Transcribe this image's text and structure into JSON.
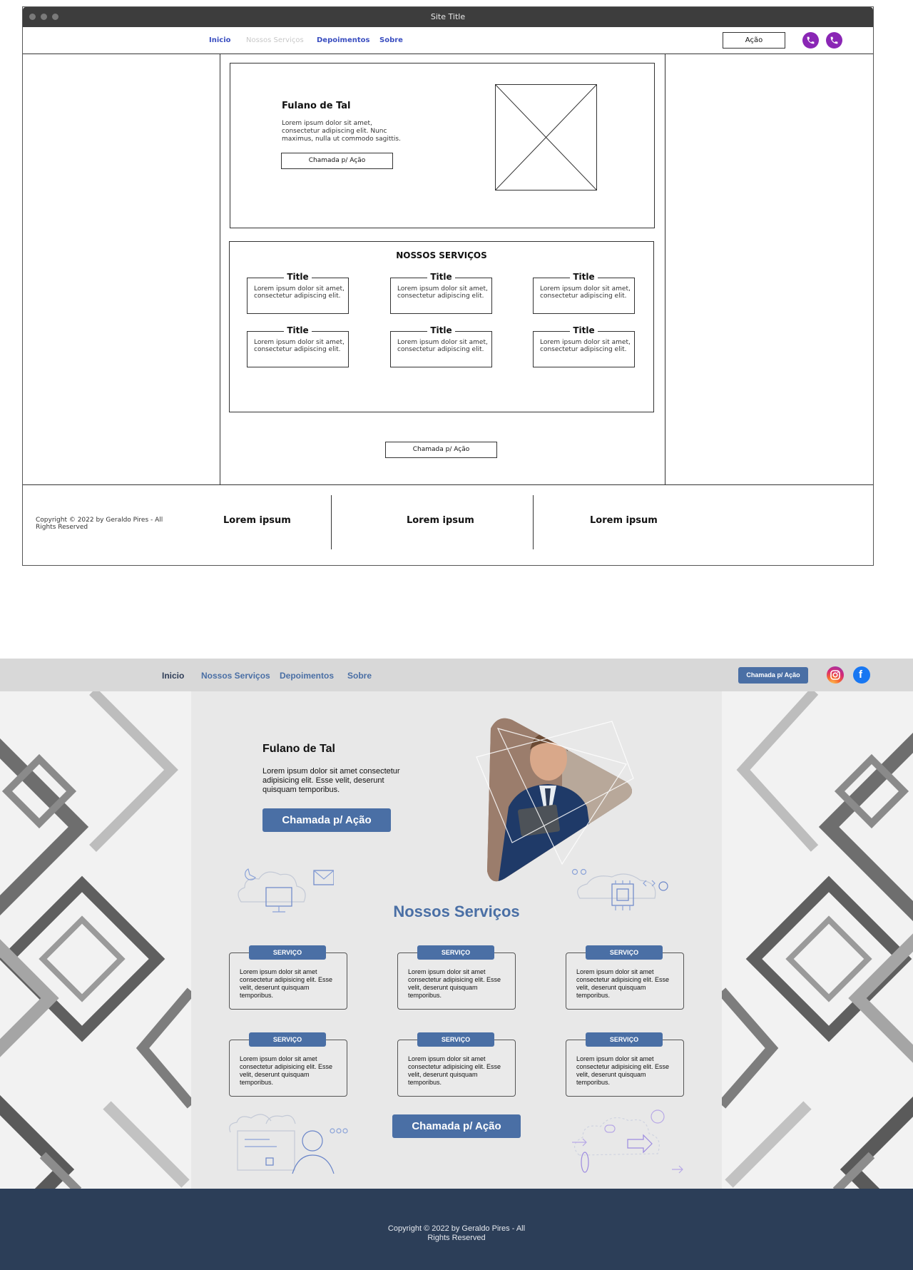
{
  "wireframe": {
    "window_title": "Site Title",
    "nav": {
      "items": [
        {
          "label": "Inicio"
        },
        {
          "label": "Nossos Serviços"
        },
        {
          "label": "Depoimentos"
        },
        {
          "label": "Sobre"
        }
      ],
      "action_label": "Ação",
      "icons": [
        "phone-icon",
        "phone-icon"
      ],
      "icon_color": "#8a26b5"
    },
    "hero": {
      "name": "Fulano de Tal",
      "text": "Lorem ipsum dolor sit amet, consectetur adipiscing elit. Nunc maximus, nulla ut commodo sagittis.",
      "cta_label": "Chamada p/ Ação"
    },
    "services": {
      "title": "NOSSOS SERVIÇOS",
      "cards": [
        {
          "title": "Title",
          "text": "Lorem ipsum dolor sit amet, consectetur adipiscing elit."
        },
        {
          "title": "Title",
          "text": "Lorem ipsum dolor sit amet, consectetur adipiscing elit."
        },
        {
          "title": "Title",
          "text": "Lorem ipsum dolor sit amet, consectetur adipiscing elit."
        },
        {
          "title": "Title",
          "text": "Lorem ipsum dolor sit amet, consectetur adipiscing elit."
        },
        {
          "title": "Title",
          "text": "Lorem ipsum dolor sit amet, consectetur adipiscing elit."
        },
        {
          "title": "Title",
          "text": "Lorem ipsum dolor sit amet, consectetur adipiscing elit."
        }
      ],
      "cta_label": "Chamada p/ Ação"
    },
    "footer": {
      "copyright": "Copyright © 2022 by Geraldo Pires - All Rights Reserved",
      "columns": [
        "Lorem ipsum",
        "Lorem ipsum",
        "Lorem ipsum"
      ]
    }
  },
  "design": {
    "colors": {
      "accent": "#4a6fa5",
      "footer": "#2c3e58",
      "nav": "#d8d8d8"
    },
    "nav": {
      "items": [
        {
          "label": "Inicio"
        },
        {
          "label": "Nossos Serviços"
        },
        {
          "label": "Depoimentos"
        },
        {
          "label": "Sobre"
        }
      ],
      "cta_label": "Chamada p/ Ação",
      "icons": [
        "instagram-icon",
        "facebook-icon"
      ]
    },
    "hero": {
      "name": "Fulano de Tal",
      "text": "Lorem ipsum dolor sit amet consectetur adipisicing elit. Esse velit, deserunt quisquam temporibus.",
      "cta_label": "Chamada p/ Ação"
    },
    "services": {
      "title": "Nossos Serviços",
      "cards": [
        {
          "tag": "SERVIÇO",
          "text": "Lorem ipsum dolor sit amet consectetur adipisicing elit. Esse velit, deserunt quisquam temporibus."
        },
        {
          "tag": "SERVIÇO",
          "text": "Lorem ipsum dolor sit amet consectetur adipisicing elit. Esse velit, deserunt quisquam temporibus."
        },
        {
          "tag": "SERVIÇO",
          "text": "Lorem ipsum dolor sit amet consectetur adipisicing elit. Esse velit, deserunt quisquam temporibus."
        },
        {
          "tag": "SERVIÇO",
          "text": "Lorem ipsum dolor sit amet consectetur adipisicing elit. Esse velit, deserunt quisquam temporibus."
        },
        {
          "tag": "SERVIÇO",
          "text": "Lorem ipsum dolor sit amet consectetur adipisicing elit. Esse velit, deserunt quisquam temporibus."
        },
        {
          "tag": "SERVIÇO",
          "text": "Lorem ipsum dolor sit amet consectetur adipisicing elit. Esse velit, deserunt quisquam temporibus."
        }
      ],
      "cta_label": "Chamada p/ Ação"
    },
    "footer": {
      "copyright_line1": "Copyright © 2022 by Geraldo Pires - All",
      "copyright_line2": "Rights Reserved"
    }
  }
}
